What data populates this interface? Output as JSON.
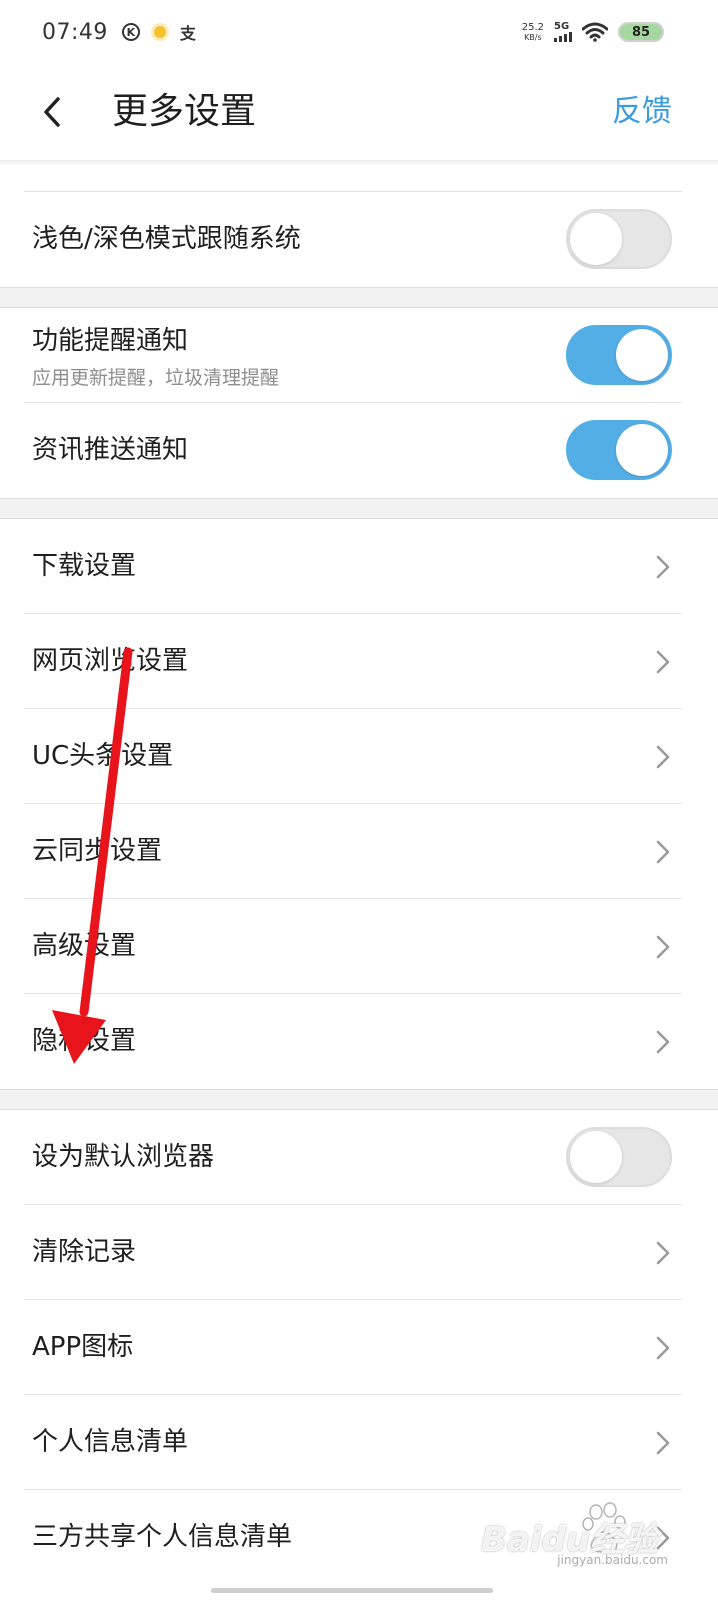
{
  "status_bar": {
    "time": "07:49",
    "net_speed_value": "25.2",
    "net_speed_unit": "KB/s",
    "network_type": "5G",
    "battery_level": "85",
    "icons": [
      "k-circle-icon",
      "sun-icon",
      "alipay-icon",
      "signal-icon",
      "wifi-icon",
      "battery-icon"
    ]
  },
  "header": {
    "title": "更多设置",
    "feedback_label": "反馈",
    "accent_color": "#3b9be0"
  },
  "groups": [
    {
      "rows": [
        {
          "label": "浅色/深色模式跟随系统",
          "control": "toggle",
          "state": "off"
        }
      ]
    },
    {
      "rows": [
        {
          "label": "功能提醒通知",
          "sublabel": "应用更新提醒，垃圾清理提醒",
          "control": "toggle",
          "state": "on"
        },
        {
          "label": "资讯推送通知",
          "control": "toggle",
          "state": "on"
        }
      ]
    },
    {
      "rows": [
        {
          "label": "下载设置",
          "control": "chevron"
        },
        {
          "label": "网页浏览设置",
          "control": "chevron"
        },
        {
          "label": "UC头条设置",
          "control": "chevron"
        },
        {
          "label": "云同步设置",
          "control": "chevron"
        },
        {
          "label": "高级设置",
          "control": "chevron"
        },
        {
          "label": "隐私设置",
          "control": "chevron"
        }
      ]
    },
    {
      "rows": [
        {
          "label": "设为默认浏览器",
          "control": "toggle",
          "state": "off"
        },
        {
          "label": "清除记录",
          "control": "chevron"
        },
        {
          "label": "APP图标",
          "control": "chevron"
        },
        {
          "label": "个人信息清单",
          "control": "chevron"
        },
        {
          "label": "三方共享个人信息清单",
          "control": "chevron"
        }
      ]
    }
  ],
  "colors": {
    "toggle_on": "#54aee6",
    "toggle_off": "#e6e6e6",
    "annotation_arrow": "#e8141c"
  },
  "watermark": {
    "text": "Baidu经验",
    "subtext": "jingyan.baidu.com"
  }
}
